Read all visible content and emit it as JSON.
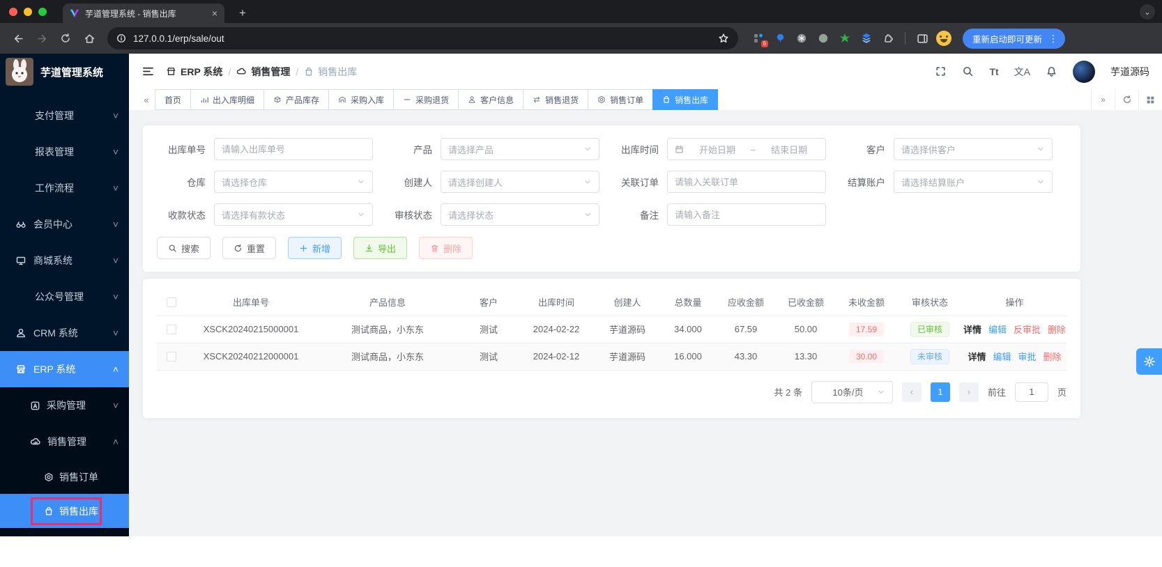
{
  "browser": {
    "tab_title": "芋道管理系统 - 销售出库",
    "url": "127.0.0.1/erp/sale/out",
    "update_button": "重新启动即可更新",
    "extension_badge": "6"
  },
  "icons": {
    "close_tab": "×",
    "new_tab": "+",
    "tab_search": "⌄",
    "kebab": "⋮",
    "collapse_left": "«",
    "collapse_right": "»",
    "prev": "‹",
    "next": "›",
    "font_size": "Tt",
    "locale": "文A",
    "chev_down": "˅",
    "chev_up": "˄",
    "range_sep": "–"
  },
  "sidebar": {
    "logo_title": "芋道管理系统",
    "items": [
      {
        "label": "支付管理"
      },
      {
        "label": "报表管理"
      },
      {
        "label": "工作流程"
      },
      {
        "label": "会员中心"
      },
      {
        "label": "商城系统"
      },
      {
        "label": "公众号管理"
      },
      {
        "label": "CRM 系统"
      },
      {
        "label": "ERP 系统"
      },
      {
        "label": "采购管理"
      },
      {
        "label": "销售管理"
      },
      {
        "label": "销售订单"
      },
      {
        "label": "销售出库"
      }
    ]
  },
  "header": {
    "breadcrumb": [
      "ERP 系统",
      "销售管理",
      "销售出库"
    ],
    "username": "芋道源码"
  },
  "tabbar": {
    "tabs": [
      "首页",
      "出入库明细",
      "产品库存",
      "采购入库",
      "采购退货",
      "客户信息",
      "销售退货",
      "销售订单",
      "销售出库"
    ]
  },
  "filters": {
    "fields": [
      {
        "label": "出库单号",
        "placeholder": "请输入出库单号"
      },
      {
        "label": "产品",
        "placeholder": "请选择产品"
      },
      {
        "label": "出库时间",
        "start": "开始日期",
        "end": "结束日期"
      },
      {
        "label": "客户",
        "placeholder": "请选择供客户"
      },
      {
        "label": "仓库",
        "placeholder": "请选择仓库"
      },
      {
        "label": "创建人",
        "placeholder": "请选择创建人"
      },
      {
        "label": "关联订单",
        "placeholder": "请输入关联订单"
      },
      {
        "label": "结算账户",
        "placeholder": "请选择结算账户"
      },
      {
        "label": "收款状态",
        "placeholder": "请选择有款状态"
      },
      {
        "label": "审核状态",
        "placeholder": "请选择状态"
      },
      {
        "label": "备注",
        "placeholder": "请输入备注"
      }
    ],
    "buttons": {
      "search": "搜索",
      "reset": "重置",
      "add": "新增",
      "export": "导出",
      "delete": "删除"
    }
  },
  "table": {
    "headers": [
      "出库单号",
      "产品信息",
      "客户",
      "出库时间",
      "创建人",
      "总数量",
      "应收金额",
      "已收金额",
      "未收金额",
      "审核状态",
      "操作"
    ],
    "rows": [
      {
        "order_no": "XSCK20240215000001",
        "product": "测试商品，小东东",
        "customer": "测试",
        "date": "2024-02-22",
        "creator": "芋道源码",
        "qty": "34.000",
        "receivable": "67.59",
        "received": "50.00",
        "unreceived": "17.59",
        "status": "已审核",
        "actions": [
          "详情",
          "编辑",
          "反审批",
          "删除"
        ]
      },
      {
        "order_no": "XSCK20240212000001",
        "product": "测试商品，小东东",
        "customer": "测试",
        "date": "2024-02-12",
        "creator": "芋道源码",
        "qty": "16.000",
        "receivable": "43.30",
        "received": "13.30",
        "unreceived": "30.00",
        "status": "未审核",
        "actions": [
          "详情",
          "编辑",
          "审批",
          "删除"
        ]
      }
    ]
  },
  "pagination": {
    "total": "共 2 条",
    "page_size": "10条/页",
    "current": "1",
    "goto_label": "前往",
    "goto_value": "1",
    "page_label": "页"
  },
  "colors": {
    "accent": "#409eff",
    "sidebar_bg": "#001529",
    "danger": "#f56c6c",
    "success": "#67c23a",
    "highlight": "#eb2f6e"
  }
}
